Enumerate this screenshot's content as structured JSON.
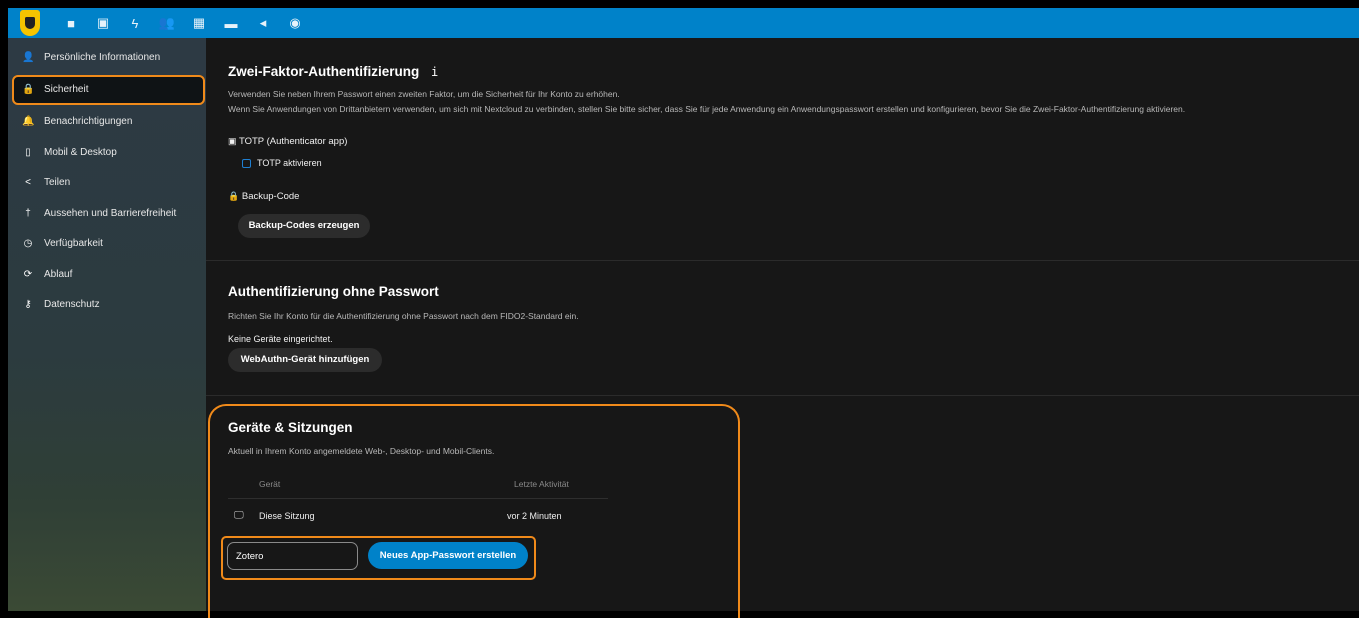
{
  "topnav": {
    "icons": [
      "files-icon",
      "photos-icon",
      "activity-icon",
      "contacts-icon",
      "calendar-icon",
      "deck-icon",
      "announcements-icon",
      "globe-icon"
    ],
    "glyphs": [
      "■",
      "▣",
      "ϟ",
      "👥",
      "▦",
      "▬",
      "◂",
      "◉"
    ]
  },
  "sidebar": {
    "items": [
      {
        "label": "Persönliche Informationen",
        "icon": "person-icon",
        "glyph": "👤"
      },
      {
        "label": "Sicherheit",
        "icon": "lock-icon",
        "glyph": "🔒"
      },
      {
        "label": "Benachrichtigungen",
        "icon": "bell-icon",
        "glyph": "🔔"
      },
      {
        "label": "Mobil & Desktop",
        "icon": "phone-icon",
        "glyph": "▯"
      },
      {
        "label": "Teilen",
        "icon": "share-icon",
        "glyph": "<"
      },
      {
        "label": "Aussehen und Barrierefreiheit",
        "icon": "accessibility-icon",
        "glyph": "†"
      },
      {
        "label": "Verfügbarkeit",
        "icon": "clock-icon",
        "glyph": "◷"
      },
      {
        "label": "Ablauf",
        "icon": "workflow-icon",
        "glyph": "⟳"
      },
      {
        "label": "Datenschutz",
        "icon": "key-icon",
        "glyph": "⚷"
      }
    ]
  },
  "twofactor": {
    "title": "Zwei-Faktor-Authentifizierung",
    "info": "i",
    "desc1": "Verwenden Sie neben Ihrem Passwort einen zweiten Faktor, um die Sicherheit für Ihr Konto zu erhöhen.",
    "desc2": "Wenn Sie Anwendungen von Drittanbietern verwenden, um sich mit Nextcloud zu verbinden, stellen Sie bitte sicher, dass Sie für jede Anwendung ein Anwendungspasswort erstellen und konfigurieren, bevor Sie die Zwei-Faktor-Authentifizierung aktivieren.",
    "totp_label": "TOTP (Authenticator app)",
    "totp_checkbox": "TOTP aktivieren",
    "backup_label": "Backup-Code",
    "backup_button": "Backup-Codes erzeugen"
  },
  "passwordless": {
    "title": "Authentifizierung ohne Passwort",
    "desc": "Richten Sie Ihr Konto für die Authentifizierung ohne Passwort nach dem FIDO2-Standard ein.",
    "no_devices": "Keine Geräte eingerichtet.",
    "add_button": "WebAuthn-Gerät hinzufügen"
  },
  "sessions": {
    "title": "Geräte & Sitzungen",
    "desc": "Aktuell in Ihrem Konto angemeldete Web-, Desktop- und Mobil-Clients.",
    "col_device": "Gerät",
    "col_activity": "Letzte Aktivität",
    "rows": [
      {
        "device": "Diese Sitzung",
        "activity": "vor 2 Minuten"
      }
    ],
    "app_name_value": "Zotero",
    "create_button": "Neues App-Passwort erstellen"
  }
}
